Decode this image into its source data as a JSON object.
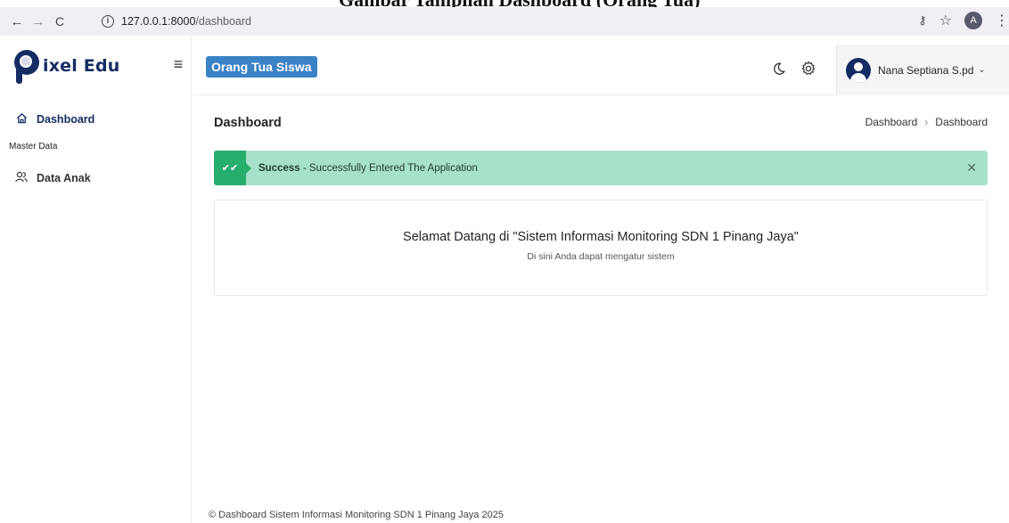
{
  "browser": {
    "url_host": "127.0.0.1:8000",
    "url_path": "/dashboard",
    "profile_initial": "A"
  },
  "sidebar": {
    "brand": "ixel Edu",
    "items": [
      {
        "label": "Dashboard",
        "icon": "home-icon",
        "active": true
      },
      {
        "label": "Data Anak",
        "icon": "users-icon",
        "active": false
      }
    ],
    "section_label": "Master Data"
  },
  "header": {
    "role_badge": "Orang Tua Siswa",
    "user_name": "Nana Septiana S.pd"
  },
  "main": {
    "page_title": "Dashboard",
    "breadcrumb": [
      "Dashboard",
      "Dashboard"
    ],
    "alert": {
      "strong": "Success",
      "message": " - Successfully Entered The Application",
      "color": "#a8e1c9"
    },
    "welcome_title": "Selamat Datang di \"Sistem Informasi Monitoring SDN 1 Pinang Jaya\"",
    "welcome_subtitle": "Di sini Anda dapat mengatur sistem"
  },
  "footer": {
    "text": "© Dashboard Sistem Informasi Monitoring SDN 1 Pinang Jaya 2025"
  },
  "colors": {
    "brand": "#142c63",
    "badge": "#3b82c6",
    "success": "#27ad6e"
  }
}
